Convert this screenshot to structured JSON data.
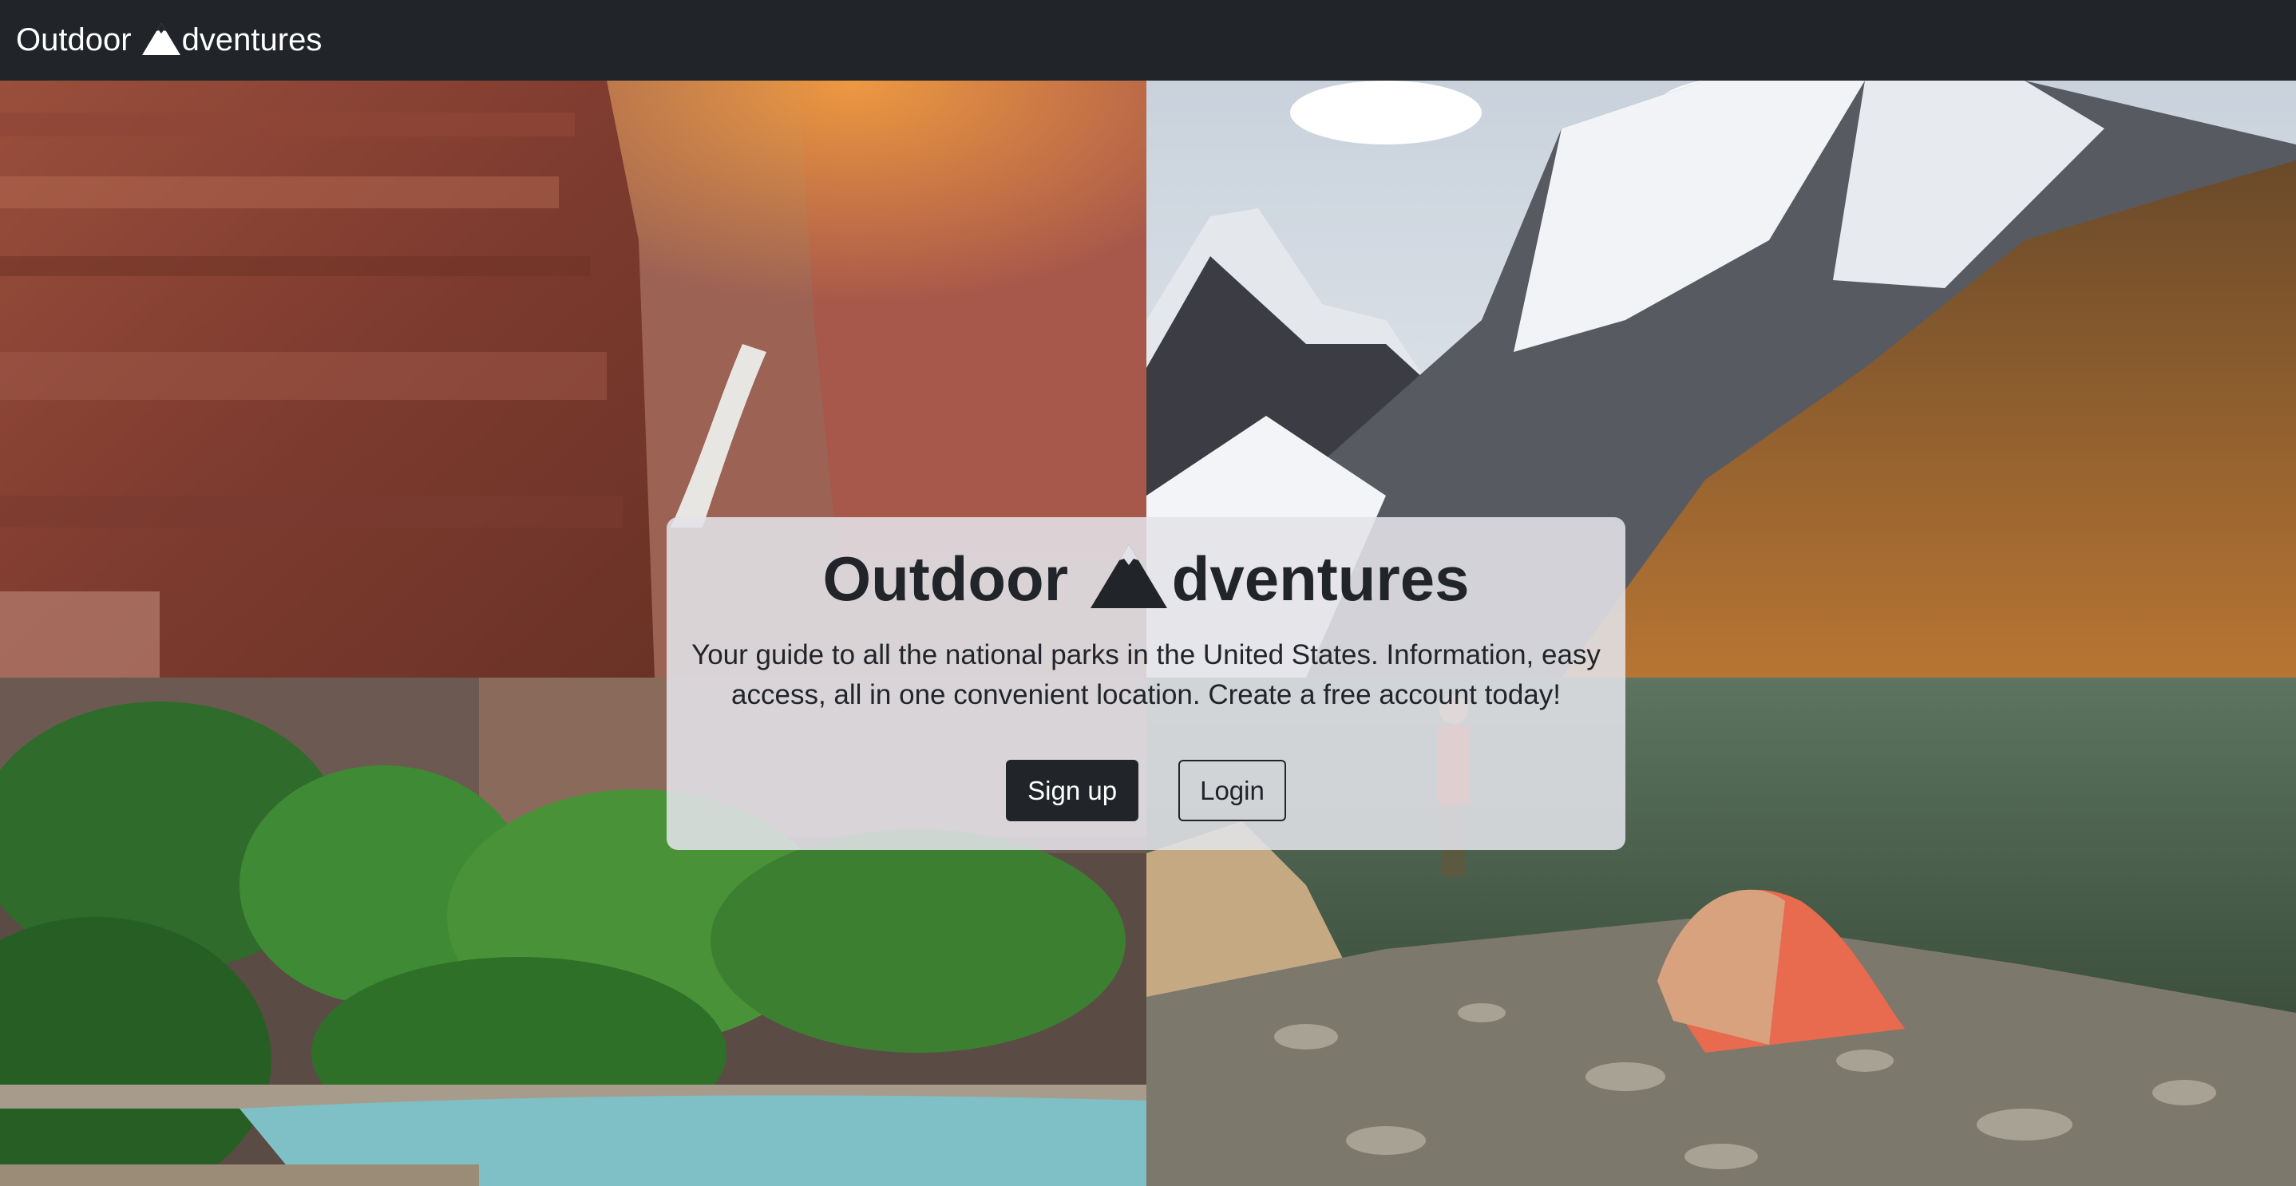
{
  "navbar": {
    "brand_before": "Outdoor ",
    "brand_after": "dventures",
    "brand_icon": "mountain-icon"
  },
  "hero": {
    "title_before": "Outdoor ",
    "title_after": "dventures",
    "title_icon": "mountain-icon",
    "description": "Your guide to all the national parks in the United States. Information, easy access, all in one convenient location. Create a free account today!",
    "signup_label": "Sign up",
    "login_label": "Login"
  },
  "photos": [
    "canyon-cliff-sunrise",
    "snowy-mountain-peaks",
    "river-with-green-trees",
    "hiker-and-tent-on-ridge"
  ],
  "colors": {
    "navbar_bg": "#212529",
    "text_dark": "#212529",
    "card_bg": "#e2e2e8"
  }
}
